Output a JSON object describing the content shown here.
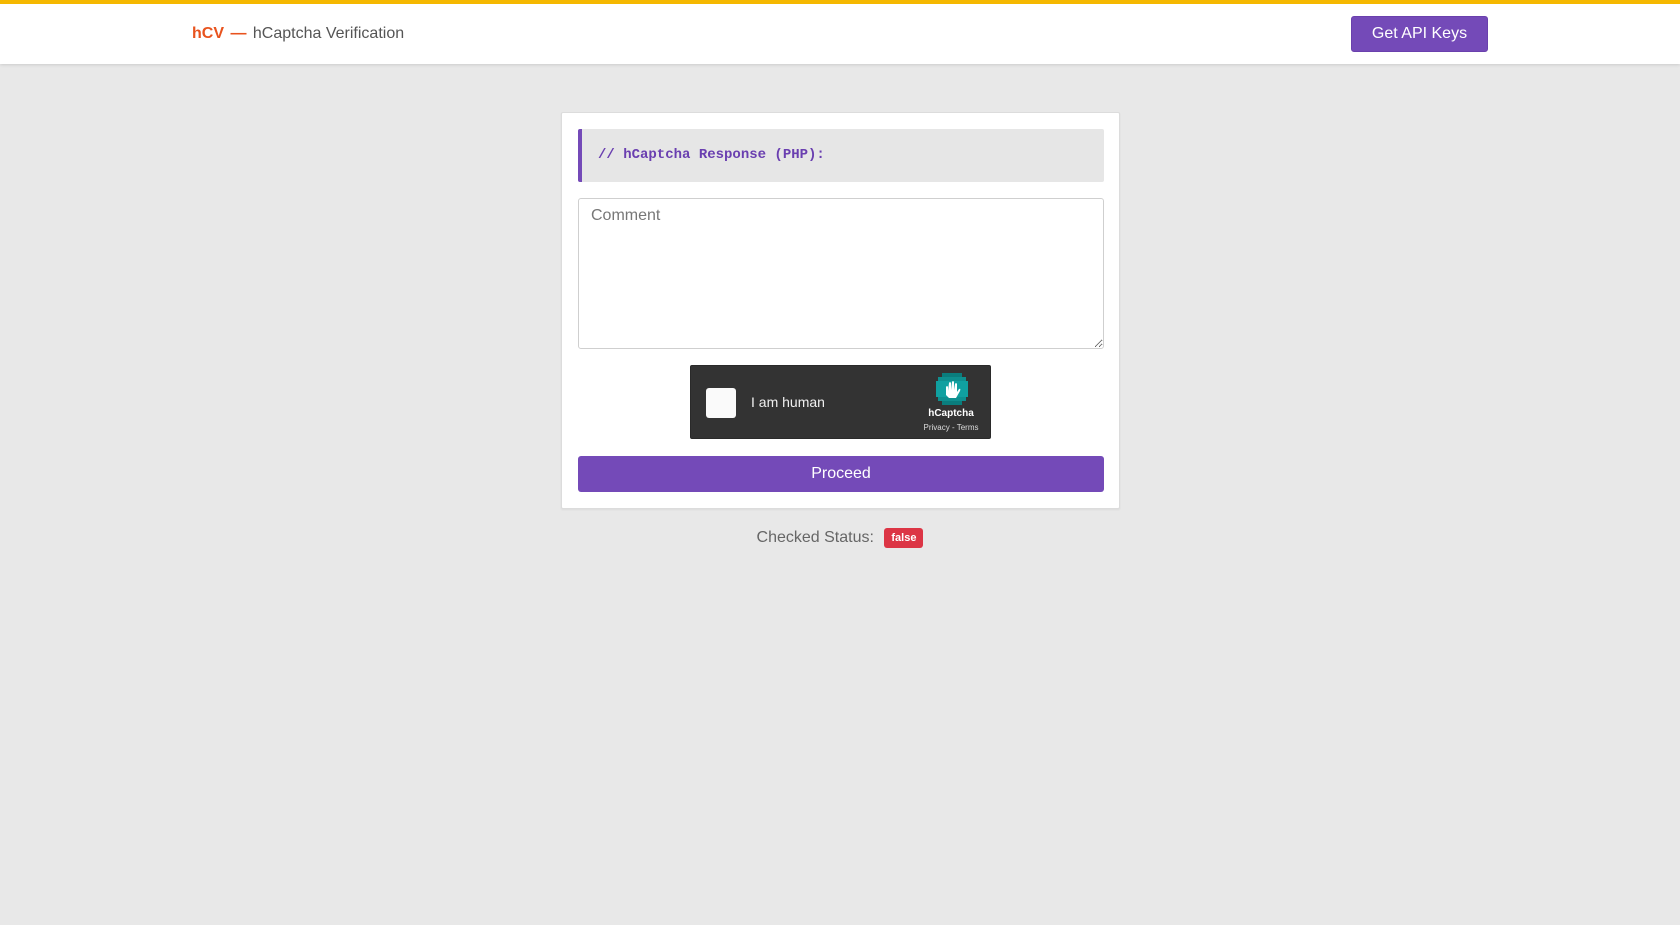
{
  "header": {
    "brand_short": "hCV",
    "brand_separator": "—",
    "brand_title": "hCaptcha Verification",
    "api_button_label": "Get API Keys"
  },
  "card": {
    "code_text": "// hCaptcha Response (PHP):",
    "comment_placeholder": "Comment",
    "comment_value": "",
    "captcha": {
      "label": "I am human",
      "brand": "hCaptcha",
      "links": "Privacy - Terms",
      "checked": false
    },
    "proceed_label": "Proceed"
  },
  "status": {
    "label": "Checked Status:",
    "value": "false"
  },
  "colors": {
    "accent": "#744ab8",
    "brand": "#e8531e",
    "top_border": "#f5b800",
    "badge_false": "#dc3545",
    "captcha_bg": "#333333"
  }
}
